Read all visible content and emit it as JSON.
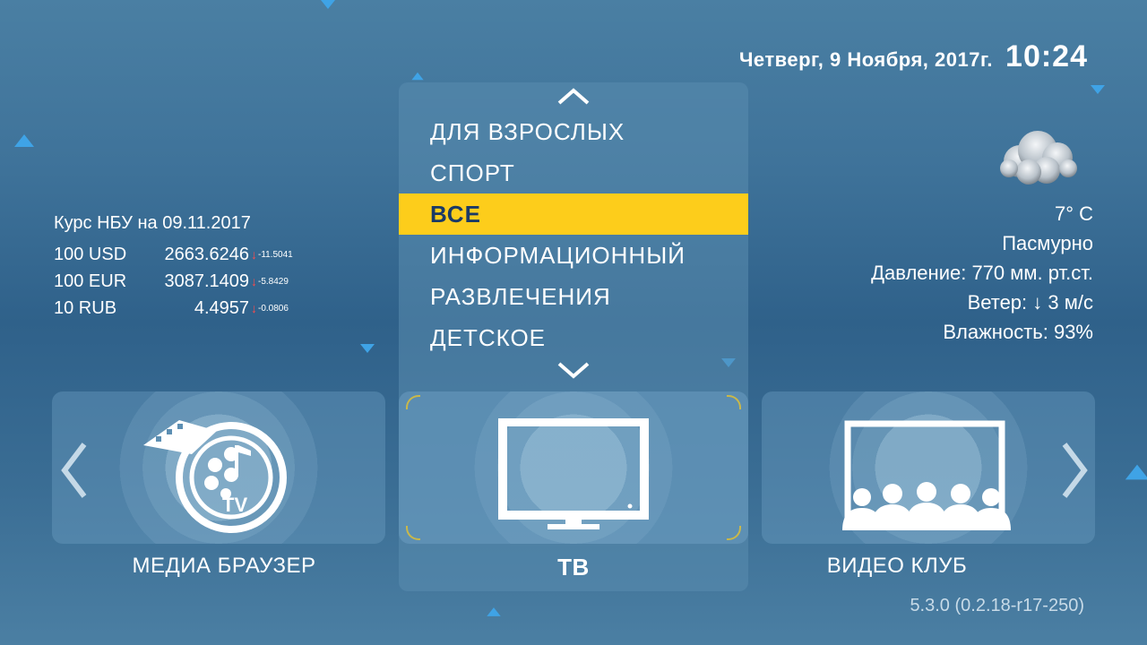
{
  "header": {
    "date": "Четверг, 9 Ноября, 2017г.",
    "time": "10:24"
  },
  "rates": {
    "title": "Курс НБУ на 09.11.2017",
    "items": [
      {
        "code": "100 USD",
        "value": "2663.6246",
        "delta": "-11.5041"
      },
      {
        "code": "100 EUR",
        "value": "3087.1409",
        "delta": "-5.8429"
      },
      {
        "code": "10 RUB",
        "value": "4.4957",
        "delta": "-0.0806"
      }
    ]
  },
  "weather": {
    "icon": "cloud-icon",
    "temperature": "7° C",
    "condition": "Пасмурно",
    "pressure": "Давление: 770 мм. рт.ст.",
    "wind_label": "Ветер:",
    "wind_arrow": "↓",
    "wind_value": "3 м/с",
    "humidity": "Влажность: 93%"
  },
  "genre_menu": {
    "items": [
      "ДЛЯ ВЗРОСЛЫХ",
      "СПОРТ",
      "ВСЕ",
      "ИНФОРМАЦИОННЫЙ",
      "РАЗВЛЕЧЕНИЯ",
      "ДЕТСКОЕ"
    ],
    "selected": "ВСЕ"
  },
  "tiles": [
    {
      "label": "МЕДИА БРАУЗЕР",
      "icon": "media-browser-icon"
    },
    {
      "label": "ТВ",
      "icon": "tv-icon",
      "selected": true
    },
    {
      "label": "ВИДЕО КЛУБ",
      "icon": "video-club-icon"
    }
  ],
  "colors": {
    "accent": "#fdcd1b",
    "accent_text": "#1b3a66",
    "star": "#3fa3e6",
    "rate_down": "#ff4a4a"
  },
  "version": "5.3.0 (0.2.18-r17-250)"
}
